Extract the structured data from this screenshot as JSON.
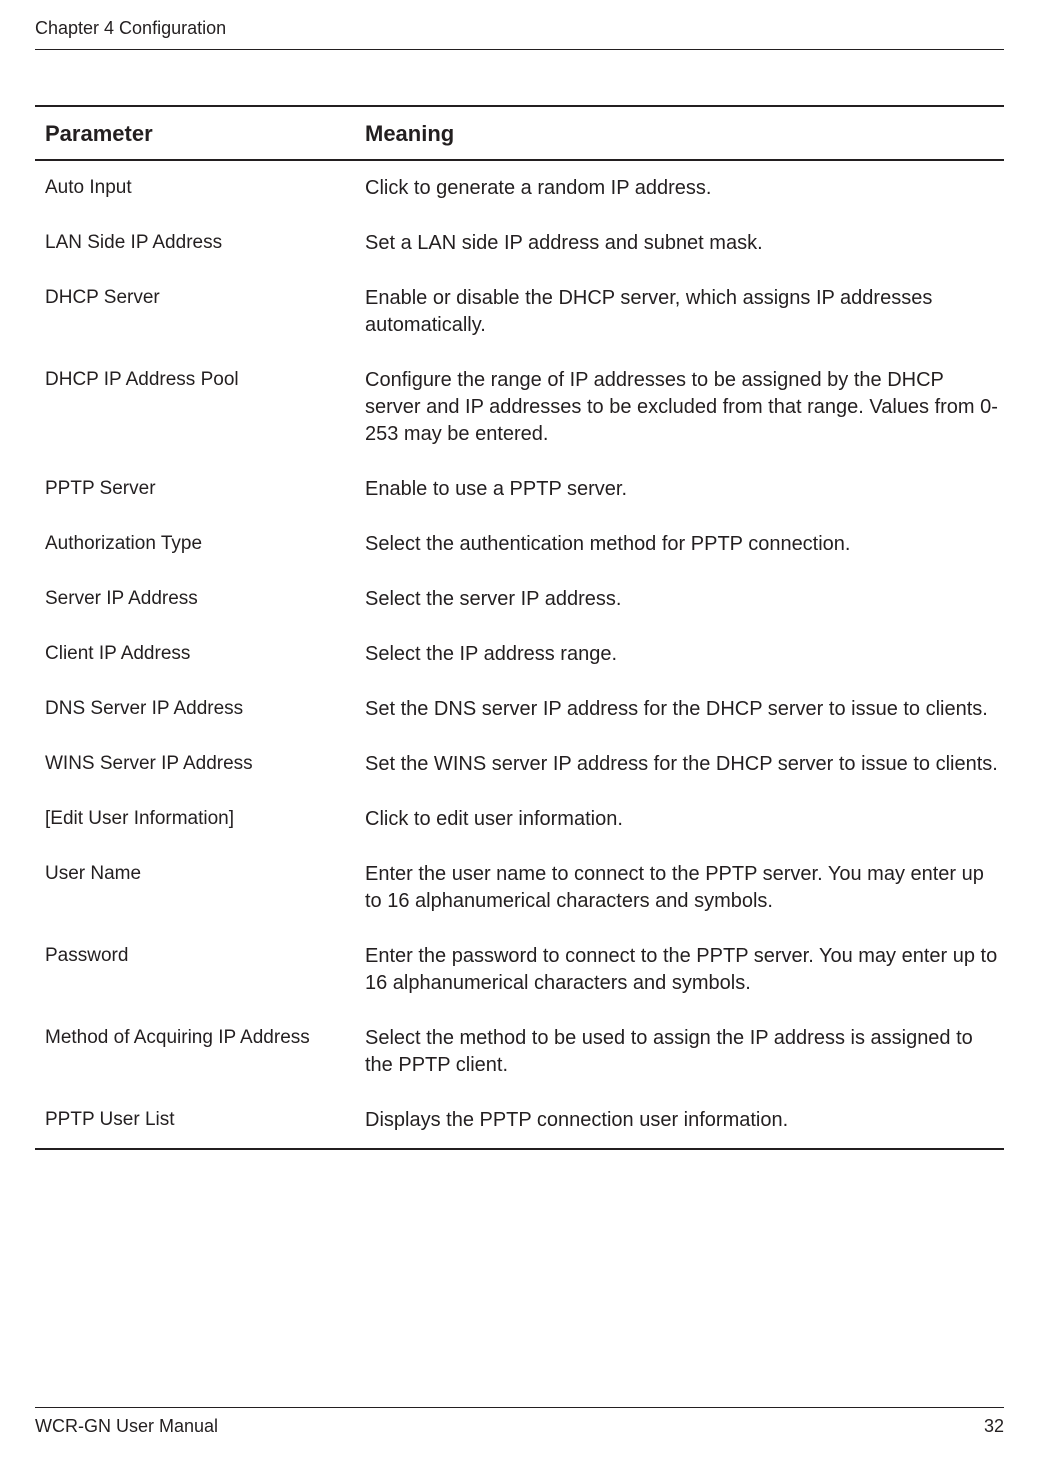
{
  "header": {
    "chapter": "Chapter 4  Configuration"
  },
  "table": {
    "headers": {
      "parameter": "Parameter",
      "meaning": "Meaning"
    },
    "rows": [
      {
        "parameter": "Auto Input",
        "meaning": "Click to generate a random IP address."
      },
      {
        "parameter": "LAN Side IP Address",
        "meaning": "Set a LAN side IP address and subnet mask."
      },
      {
        "parameter": "DHCP Server",
        "meaning": "Enable or disable the DHCP server, which assigns IP addresses automatically."
      },
      {
        "parameter": "DHCP IP Address Pool",
        "meaning": "Configure the range of IP addresses to be assigned by the DHCP server and IP addresses to be excluded from that range. Values from 0-253 may be entered."
      },
      {
        "parameter": "PPTP Server",
        "meaning": "Enable to use a PPTP server."
      },
      {
        "parameter": "Authorization Type",
        "meaning": "Select the authentication method for PPTP connection."
      },
      {
        "parameter": "Server IP Address",
        "meaning": "Select the server IP address."
      },
      {
        "parameter": "Client IP Address",
        "meaning": "Select the IP address range."
      },
      {
        "parameter": "DNS Server IP Address",
        "meaning": "Set the DNS server IP address for the DHCP server to issue to clients."
      },
      {
        "parameter": "WINS Server IP Address",
        "meaning": "Set the WINS server IP address for the DHCP server to issue to clients."
      },
      {
        "parameter": "[Edit User Information]",
        "meaning": "Click to edit user information."
      },
      {
        "parameter": "User Name",
        "meaning": "Enter the user name to connect to the PPTP server. You may enter up to 16 alphanumerical characters and symbols."
      },
      {
        "parameter": "Password",
        "meaning": "Enter the password to connect to the PPTP server. You may enter up to 16 alphanumerical characters and symbols."
      },
      {
        "parameter": "Method of Acquiring IP Address",
        "meaning": "Select the method to be used to assign the IP address is assigned to the PPTP client."
      },
      {
        "parameter": "PPTP User List",
        "meaning": "Displays the PPTP connection user information."
      }
    ]
  },
  "footer": {
    "manual": "WCR-GN User Manual",
    "page": "32"
  }
}
